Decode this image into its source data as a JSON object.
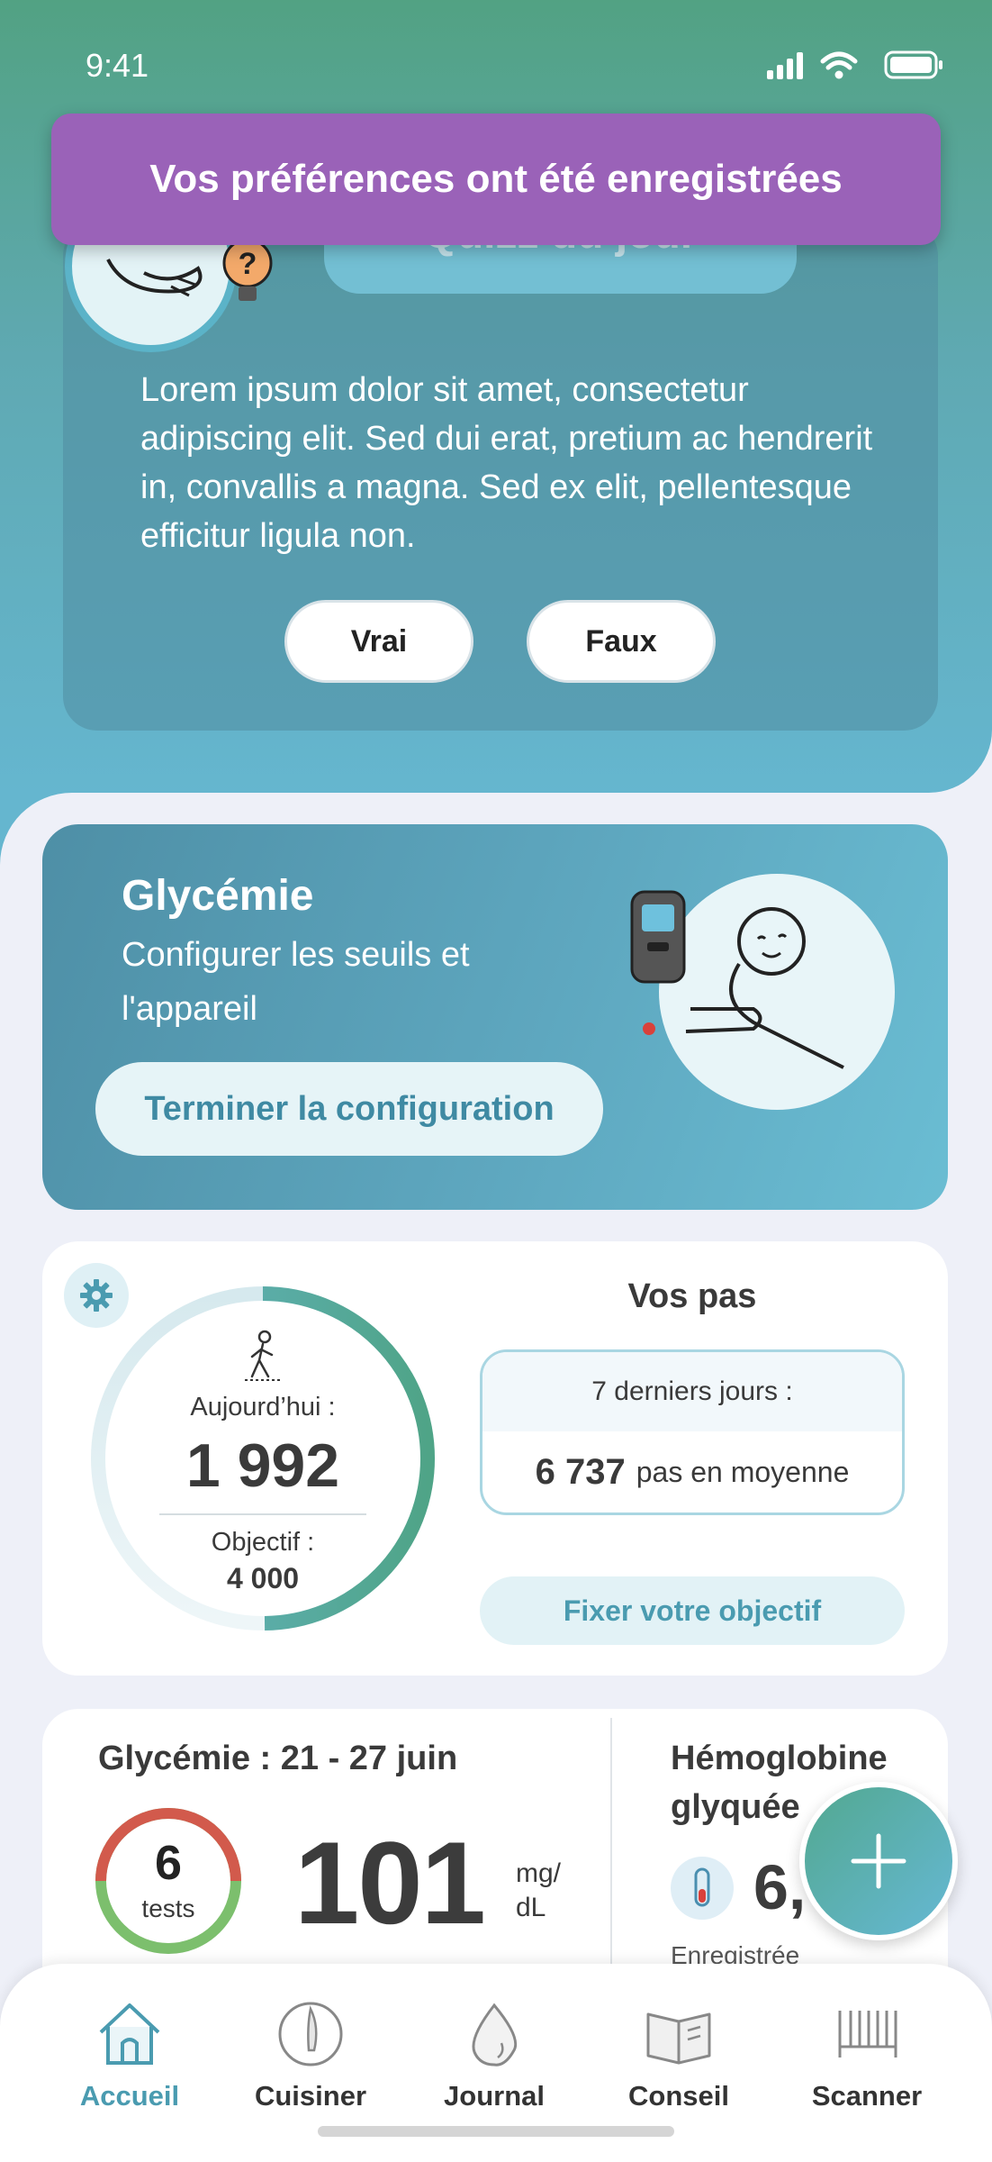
{
  "status_bar": {
    "time": "9:41"
  },
  "toast": {
    "message": "Vos préférences ont été enregistrées"
  },
  "quiz": {
    "title": "Quizz du jour",
    "text": "Lorem ipsum dolor sit amet, consectetur adipiscing elit. Sed dui erat, pretium ac hendrerit in, convallis a magna. Sed ex elit, pellentesque efficitur ligula non.",
    "true_label": "Vrai",
    "false_label": "Faux"
  },
  "glycemia_setup": {
    "title": "Glycémie",
    "subtitle_line1": "Configurer les seuils et",
    "subtitle_line2": "l'appareil",
    "button_label": "Terminer la configuration"
  },
  "steps": {
    "title": "Vos pas",
    "today_label": "Aujourd’hui :",
    "today_value": "1 992",
    "goal_label": "Objectif :",
    "goal_value": "4 000",
    "progress_fraction": 0.498,
    "week_label": "7 derniers jours :",
    "week_value": "6 737",
    "week_suffix": "pas en moyenne",
    "goal_button": "Fixer votre objectif"
  },
  "glycemia_summary": {
    "title": "Glycémie : 21 - 27 juin",
    "tests_count": "6",
    "tests_label": "tests",
    "value": "101",
    "unit_line1": "mg/",
    "unit_line2": "dL"
  },
  "hba1c": {
    "title_line1": "Hémoglobine",
    "title_line2": "glyquée",
    "value": "6,",
    "recorded_label": "Enregistrée"
  },
  "nav": {
    "items": [
      {
        "label": "Accueil",
        "active": true
      },
      {
        "label": "Cuisiner"
      },
      {
        "label": "Journal"
      },
      {
        "label": "Conseil"
      },
      {
        "label": "Scanner"
      }
    ]
  },
  "colors": {
    "accent": "#4a9bb0",
    "toast": "#9a62b8",
    "hero_top": "#52a283",
    "hero_bottom": "#65b6cf"
  }
}
